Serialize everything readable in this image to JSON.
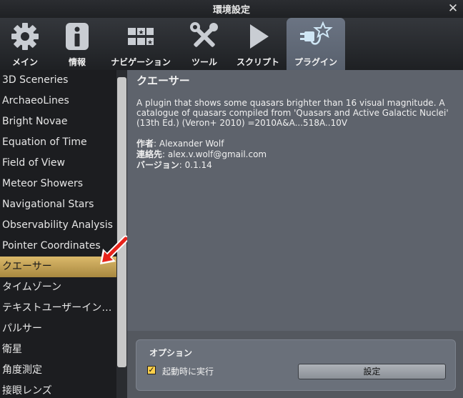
{
  "window": {
    "title": "環境設定",
    "close_glyph": "✕"
  },
  "tabs": [
    {
      "label": "メイン",
      "icon": "gear-icon"
    },
    {
      "label": "情報",
      "icon": "info-icon"
    },
    {
      "label": "ナビゲーション",
      "icon": "navigation-icon"
    },
    {
      "label": "ツール",
      "icon": "tools-icon"
    },
    {
      "label": "スクリプト",
      "icon": "script-play-icon"
    },
    {
      "label": "プラグイン",
      "icon": "plugin-icon",
      "active": true
    }
  ],
  "plugins": [
    "3D Sceneries",
    "ArchaeoLines",
    "Bright Novae",
    "Equation of Time",
    "Field of View",
    "Meteor Showers",
    "Navigational Stars",
    "Observability Analysis",
    "Pointer Coordinates",
    "クエーサー",
    "タイムゾーン",
    "テキストユーザーインタ...",
    "パルサー",
    "衛星",
    "角度測定",
    "接眼レンズ"
  ],
  "selected_index": 9,
  "details": {
    "title": "クエーサー",
    "description": "A plugin that shows some quasars brighter than 16 visual magnitude. A catalogue of quasars compiled from 'Quasars and Active Galactic Nuclei' (13th Ed.) (Veron+ 2010) =2010A&A...518A..10V",
    "author_label": "作者",
    "author": ": Alexander Wolf",
    "contact_label": "連絡先",
    "contact": ": alex.v.wolf@gmail.com",
    "version_label": "バージョン",
    "version": ": 0.1.14"
  },
  "options": {
    "title": "オプション",
    "load_at_startup_label": "起動時に実行",
    "load_at_startup_checked": true,
    "check_glyph": "✓",
    "settings_button": "設定"
  },
  "colors": {
    "accent_selected": "#c9a85a",
    "arrow": "#e8231a",
    "checkbox": "#ffd04a"
  }
}
